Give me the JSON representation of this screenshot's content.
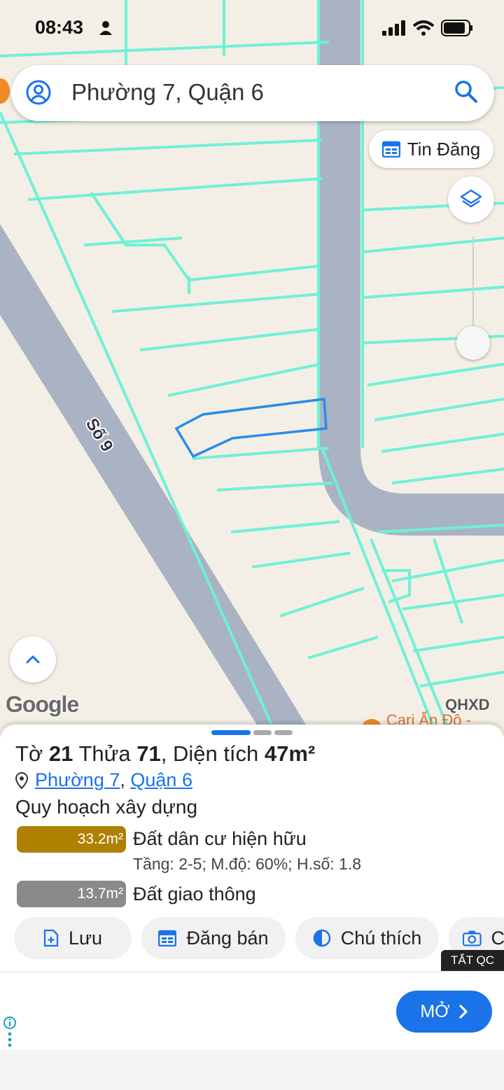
{
  "status_bar": {
    "time": "08:43"
  },
  "search": {
    "query": "Phường 7, Quận 6"
  },
  "map": {
    "tin_dang_label": "Tin Đăng",
    "road_label": "Số 9",
    "attribution": "Google",
    "layer_badge": "QHXD",
    "poi_label": "Cari Ấn Độ - Phở",
    "colors": {
      "parcel_lines": "#6ff1d6",
      "road": "#a9b3c3",
      "selected_parcel": "#2a8ce8",
      "background": "#f3efe6"
    }
  },
  "sheet": {
    "title": {
      "to_prefix": "Tờ",
      "to": "21",
      "thua_prefix": "Thửa",
      "thua": "71",
      "area_prefix": ", Diện tích",
      "area": "47m²"
    },
    "location": {
      "ward": "Phường 7",
      "separator": ",",
      "district": "Quận 6"
    },
    "section_title": "Quy hoạch xây dựng",
    "zones": [
      {
        "area": "33.2m²",
        "label": "Đất dân cư hiện hữu",
        "detail": "Tầng: 2-5; M.độ: 60%; H.số: 1.8",
        "color": "#ae8100"
      },
      {
        "area": "13.7m²",
        "label": "Đất giao thông",
        "color": "#8a8a8a"
      }
    ],
    "actions": [
      {
        "label": "Lưu",
        "icon": "save-doc-icon"
      },
      {
        "label": "Đăng bán",
        "icon": "calendar-icon"
      },
      {
        "label": "Chú thích",
        "icon": "half-circle-icon"
      },
      {
        "label": "C",
        "icon": "camera-icon"
      }
    ]
  },
  "ad": {
    "close_label": "TẮT QC",
    "open_label": "MỞ"
  }
}
